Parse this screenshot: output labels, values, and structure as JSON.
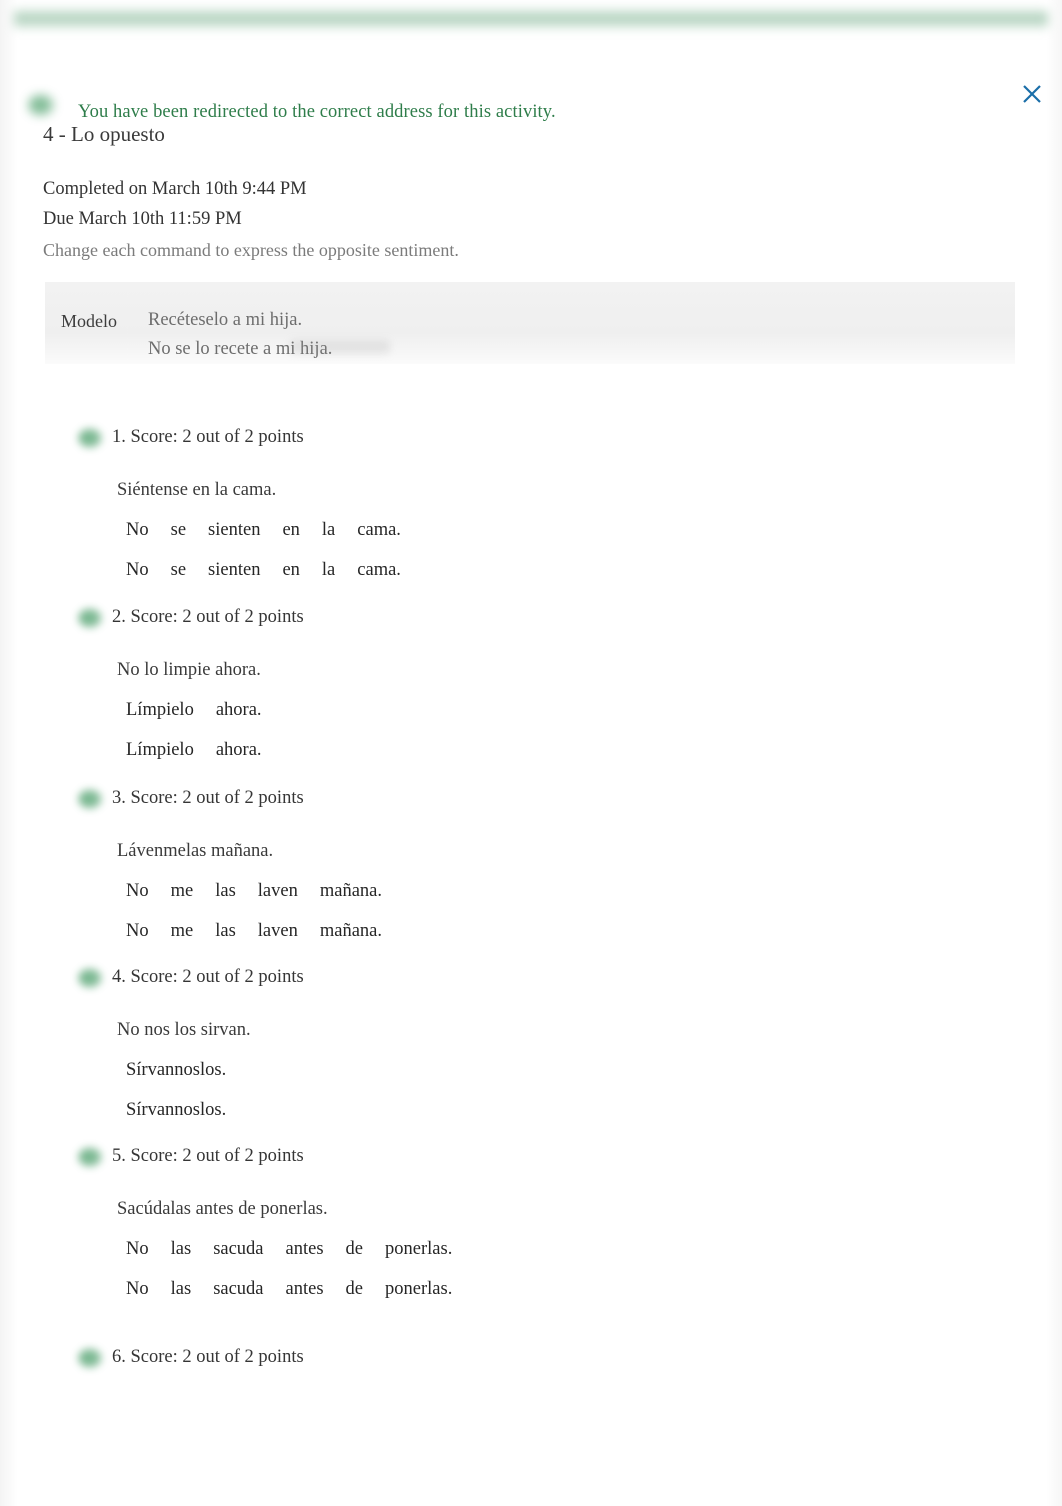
{
  "notification": {
    "icon": "check-circle-icon",
    "message": "You have been redirected to the correct address for this activity.",
    "close_icon": "close-icon",
    "text_color": "#2e7d4a"
  },
  "activity": {
    "title": "4 - Lo opuesto",
    "completed_on": "Completed on March 10th 9:44 PM",
    "due": "Due March 10th 11:59 PM",
    "directions": "Change each command to express the opposite sentiment."
  },
  "modelo": {
    "label": "Modelo",
    "prompt": "Recéteselo a mi hija.",
    "answer": "No se lo recete a mi hija."
  },
  "questions": [
    {
      "number": "1.",
      "score": "1. Score: 2 out of 2 points",
      "icon": "check-circle-icon",
      "prompt": "Siéntense en la cama.",
      "user_answer_words": [
        "No",
        "se",
        "sienten",
        "en",
        "la",
        "cama."
      ],
      "correct_answer_words": [
        "No",
        "se",
        "sienten",
        "en",
        "la",
        "cama."
      ]
    },
    {
      "number": "2.",
      "score": "2. Score: 2 out of 2 points",
      "icon": "check-circle-icon",
      "prompt": "No lo limpie ahora.",
      "user_answer_words": [
        "Límpielo",
        "ahora."
      ],
      "correct_answer_words": [
        "Límpielo",
        "ahora."
      ]
    },
    {
      "number": "3.",
      "score": "3. Score: 2 out of 2 points",
      "icon": "check-circle-icon",
      "prompt": "Lávenmelas mañana.",
      "user_answer_words": [
        "No",
        "me",
        "las",
        "laven",
        "mañana."
      ],
      "correct_answer_words": [
        "No",
        "me",
        "las",
        "laven",
        "mañana."
      ]
    },
    {
      "number": "4.",
      "score": "4. Score: 2 out of 2 points",
      "icon": "check-circle-icon",
      "prompt": "No nos los sirvan.",
      "user_answer_words": [
        "Sírvannoslos."
      ],
      "correct_answer_words": [
        "Sírvannoslos."
      ]
    },
    {
      "number": "5.",
      "score": "5. Score: 2 out of 2 points",
      "icon": "check-circle-icon",
      "prompt": "Sacúdalas antes de ponerlas.",
      "user_answer_words": [
        "No",
        "las",
        "sacuda",
        "antes",
        "de",
        "ponerlas."
      ],
      "correct_answer_words": [
        "No",
        "las",
        "sacuda",
        "antes",
        "de",
        "ponerlas."
      ]
    },
    {
      "number": "6.",
      "score": "6. Score: 2 out of 2 points",
      "icon": "check-circle-icon",
      "prompt": "",
      "user_answer_words": [],
      "correct_answer_words": []
    }
  ],
  "layout": {
    "question_tops": [
      0,
      180,
      361,
      540,
      719,
      920
    ]
  }
}
